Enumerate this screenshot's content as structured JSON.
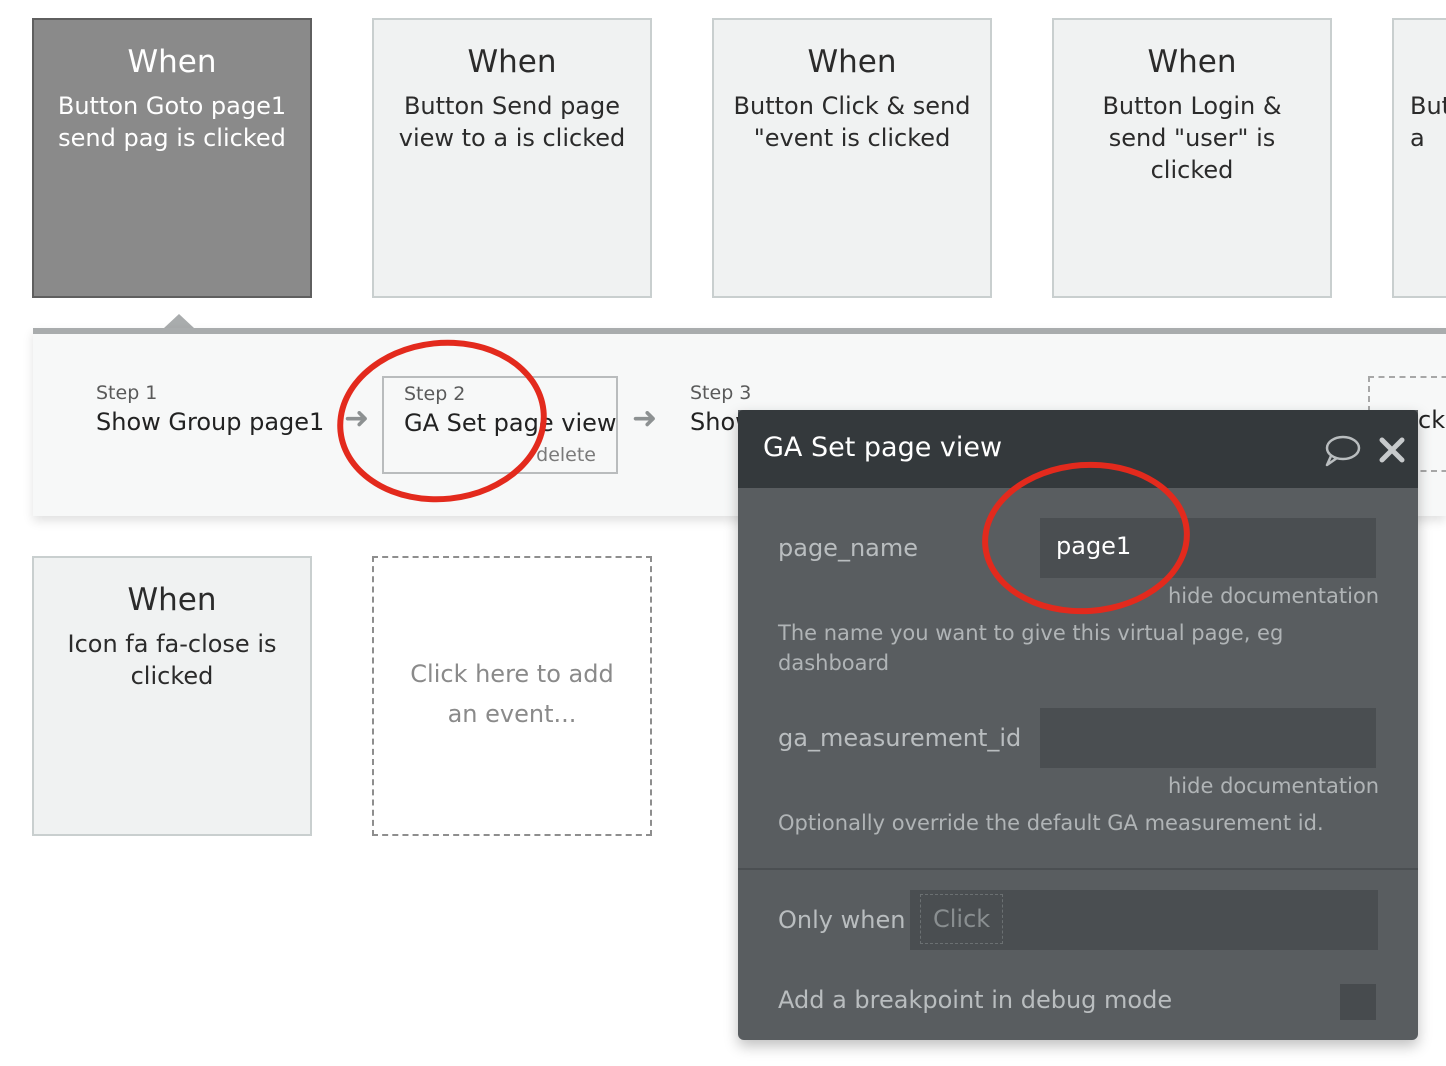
{
  "events": [
    {
      "when": "When",
      "description": "Button Goto page1 send pag is clicked"
    },
    {
      "when": "When",
      "description": "Button Send page view to a is clicked"
    },
    {
      "when": "When",
      "description": "Button Click & send \"event is clicked"
    },
    {
      "when": "When",
      "description": "Button Login & send \"user\" is clicked"
    },
    {
      "when": "",
      "description": "But a"
    },
    {
      "when": "When",
      "description": "Icon fa fa-close is clicked"
    }
  ],
  "add_event_text": "Click here to add an event...",
  "steps": [
    {
      "number": "Step 1",
      "name": "Show Group page1"
    },
    {
      "number": "Step 2",
      "name": "GA Set page view",
      "delete_label": "delete"
    },
    {
      "number": "Step 3",
      "name": "Show"
    }
  ],
  "strip_clipped_text": "ck",
  "editor": {
    "title": "GA Set page view",
    "fields": [
      {
        "label": "page_name",
        "value": "page1",
        "hide_doc_label": "hide documentation",
        "documentation": "The name you want to give this virtual page, eg dashboard"
      },
      {
        "label": "ga_measurement_id",
        "value": "",
        "hide_doc_label": "hide documentation",
        "documentation": "Optionally override the default GA measurement id."
      }
    ],
    "only_when_label": "Only when",
    "only_when_value": "Click",
    "breakpoint_label": "Add a breakpoint in debug mode"
  },
  "colors": {
    "annotation_red": "#e32a1d",
    "editor_bg": "#595d60",
    "editor_header": "#34393c",
    "selected_card": "#8a8a8a"
  }
}
